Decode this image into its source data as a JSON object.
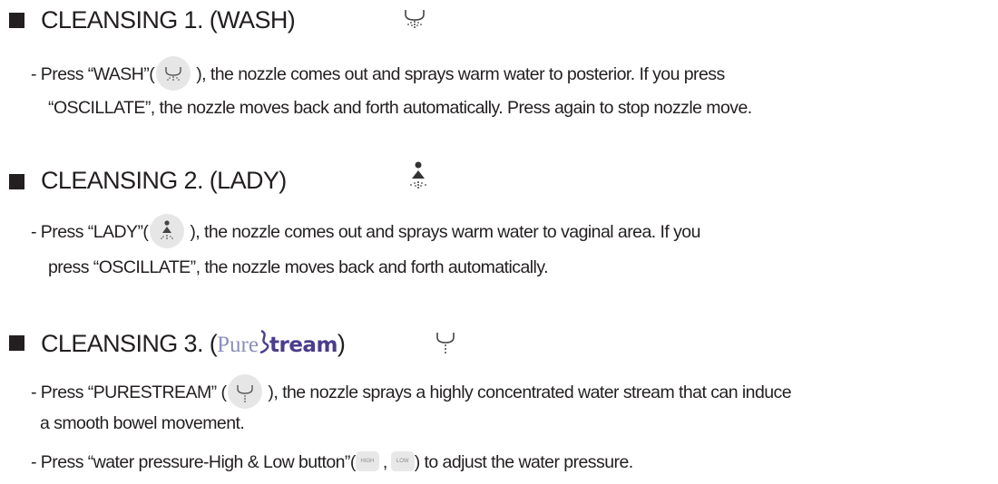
{
  "sections": [
    {
      "heading": "CLEANSING 1. (WASH)",
      "icon": "wash-icon",
      "lines": {
        "l1_pre": "- Press  “WASH”(",
        "l1_post": "), the nozzle comes out and sprays warm water to posterior. If you press",
        "l2": "“OSCILLATE”,  the nozzle moves back and forth automatically. Press again to stop nozzle move."
      }
    },
    {
      "heading": "CLEANSING 2. (LADY)",
      "icon": "lady-icon",
      "lines": {
        "l1_pre": "- Press  “LADY”(",
        "l1_post": "), the nozzle comes out and sprays warm  water to vaginal area.  If you",
        "l2": "press “OSCILLATE”,  the nozzle moves back and forth automatically."
      }
    },
    {
      "heading_pre": "CLEANSING 3. (",
      "heading_post": ")",
      "icon": "purestream-icon",
      "lines": {
        "l1_pre": "- Press “PURESTREAM”  (",
        "l1_post": "), the nozzle sprays a highly concentrated water stream that can induce",
        "l2": "a smooth bowel movement.",
        "l3_pre": "- Press “water pressure-High & Low button”(",
        "l3_sep": ",",
        "l3_post": ") to adjust the water pressure."
      }
    }
  ],
  "brand": {
    "part1": "Pure",
    "part2": "tream"
  },
  "pressure_buttons": {
    "high": "HIGH",
    "low": "LOW"
  },
  "colors": {
    "text": "#231f20",
    "brand_light": "#8a8fb8",
    "brand_dark": "#4b3c8c",
    "icon_bg": "#e6e6e6"
  }
}
